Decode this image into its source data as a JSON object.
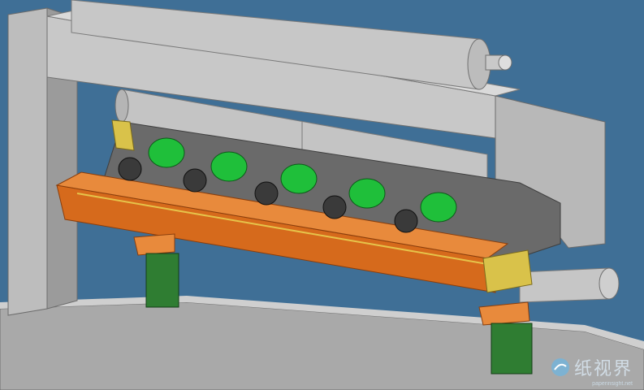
{
  "scene": {
    "description_colors": {
      "background": "#3f6f96",
      "frame": "#bdbdbd",
      "frame_dark": "#8e8e8e",
      "roller": "#c7c7c7",
      "beam_orange": "#d66a1c",
      "motor_green": "#1fbf3a",
      "support_green": "#2f7d32",
      "bracket_yellow": "#d9c24a"
    },
    "motor_count": 5
  },
  "watermark": {
    "text": "纸视界",
    "url": "paperinsight.net",
    "icon": "paperinsight-logo-icon"
  }
}
